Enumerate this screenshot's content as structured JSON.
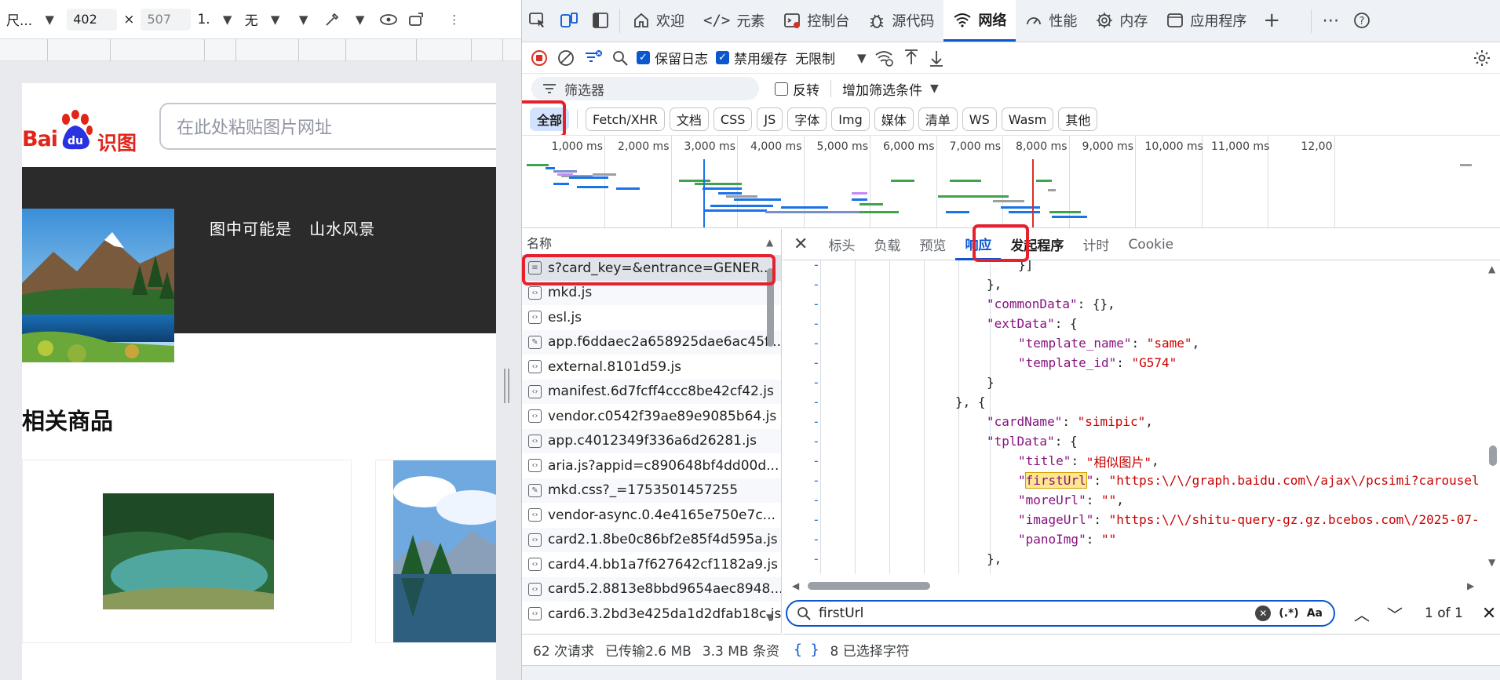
{
  "device_toolbar": {
    "dimensions_label": "尺...",
    "width_value": "402",
    "times_sign": "×",
    "height_value": "507",
    "zoom_label": "1.",
    "throttle_label": "无"
  },
  "page": {
    "logo_text_left": "Bai",
    "logo_paw_text": "du",
    "logo_text_right": "识图",
    "search_placeholder": "在此处粘贴图片网址",
    "result_label": "图中可能是",
    "result_value": "山水风景",
    "related_title": "相关商品"
  },
  "devtools_tabs": [
    {
      "name": "welcome",
      "label": "欢迎",
      "icon": "home-icon"
    },
    {
      "name": "elements",
      "label": "元素",
      "icon": "code-brackets-icon"
    },
    {
      "name": "console",
      "label": "控制台",
      "icon": "console-icon"
    },
    {
      "name": "sources",
      "label": "源代码",
      "icon": "bug-icon"
    },
    {
      "name": "network",
      "label": "网络",
      "icon": "wifi-icon"
    },
    {
      "name": "performance",
      "label": "性能",
      "icon": "gauge-icon"
    },
    {
      "name": "memory",
      "label": "内存",
      "icon": "chip-icon"
    },
    {
      "name": "application",
      "label": "应用程序",
      "icon": "window-icon"
    }
  ],
  "net_toolbar": {
    "preserve_log": "保留日志",
    "disable_cache": "禁用缓存",
    "throttling": "无限制"
  },
  "filter": {
    "placeholder": "筛选器",
    "invert": "反转",
    "more_filters": "增加筛选条件"
  },
  "type_filters": [
    "全部",
    "Fetch/XHR",
    "文档",
    "CSS",
    "JS",
    "字体",
    "Img",
    "媒体",
    "清单",
    "WS",
    "Wasm",
    "其他"
  ],
  "timeline": {
    "ticks": [
      "1,000 ms",
      "2,000 ms",
      "3,000 ms",
      "4,000 ms",
      "5,000 ms",
      "6,000 ms",
      "7,000 ms",
      "8,000 ms",
      "9,000 ms",
      "10,000 ms",
      "11,000 ms",
      "12,00"
    ]
  },
  "requests": {
    "header": "名称",
    "items": [
      {
        "name": "s?card_key=&entrance=GENER...",
        "icon": "document-icon"
      },
      {
        "name": "mkd.js",
        "icon": "script-icon"
      },
      {
        "name": "esl.js",
        "icon": "script-icon"
      },
      {
        "name": "app.f6ddaec2a658925dae6ac45f...",
        "icon": "stylesheet-icon"
      },
      {
        "name": "external.8101d59.js",
        "icon": "script-icon"
      },
      {
        "name": "manifest.6d7fcff4ccc8be42cf42.js",
        "icon": "script-icon"
      },
      {
        "name": "vendor.c0542f39ae89e9085b64.js",
        "icon": "script-icon"
      },
      {
        "name": "app.c4012349f336a6d26281.js",
        "icon": "script-icon"
      },
      {
        "name": "aria.js?appid=c890648bf4dd00d...",
        "icon": "script-icon"
      },
      {
        "name": "mkd.css?_=1753501457255",
        "icon": "stylesheet-icon"
      },
      {
        "name": "vendor-async.0.4e4165e750e7c...",
        "icon": "script-icon"
      },
      {
        "name": "card2.1.8be0c86bf2e85f4d595a.js",
        "icon": "script-icon"
      },
      {
        "name": "card4.4.bb1a7f627642cf1182a9.js",
        "icon": "script-icon"
      },
      {
        "name": "card5.2.8813e8bbd9654aec8948...",
        "icon": "script-icon"
      },
      {
        "name": "card6.3.2bd3e425da1d2dfab18c.js",
        "icon": "script-icon"
      }
    ]
  },
  "detail_tabs": [
    "标头",
    "负载",
    "预览",
    "响应",
    "发起程序",
    "计时",
    "Cookie"
  ],
  "code_lines": [
    {
      "indent": 7,
      "tokens": [
        [
          "p",
          "}]"
        ]
      ]
    },
    {
      "indent": 6,
      "tokens": [
        [
          "p",
          "},"
        ]
      ]
    },
    {
      "indent": 6,
      "tokens": [
        [
          "k",
          "\"commonData\""
        ],
        [
          "p",
          ": {},"
        ]
      ]
    },
    {
      "indent": 6,
      "tokens": [
        [
          "k",
          "\"extData\""
        ],
        [
          "p",
          ": {"
        ]
      ]
    },
    {
      "indent": 7,
      "tokens": [
        [
          "k",
          "\"template_name\""
        ],
        [
          "p",
          ": "
        ],
        [
          "s",
          "\"same\""
        ],
        [
          "p",
          ","
        ]
      ]
    },
    {
      "indent": 7,
      "tokens": [
        [
          "k",
          "\"template_id\""
        ],
        [
          "p",
          ": "
        ],
        [
          "s",
          "\"G574\""
        ]
      ]
    },
    {
      "indent": 6,
      "tokens": [
        [
          "p",
          "}"
        ]
      ]
    },
    {
      "indent": 5,
      "tokens": [
        [
          "p",
          "}, {"
        ]
      ]
    },
    {
      "indent": 6,
      "tokens": [
        [
          "k",
          "\"cardName\""
        ],
        [
          "p",
          ": "
        ],
        [
          "s",
          "\"simipic\""
        ],
        [
          "p",
          ","
        ]
      ]
    },
    {
      "indent": 6,
      "tokens": [
        [
          "k",
          "\"tplData\""
        ],
        [
          "p",
          ": {"
        ]
      ]
    },
    {
      "indent": 7,
      "tokens": [
        [
          "k",
          "\"title\""
        ],
        [
          "p",
          ": "
        ],
        [
          "s",
          "\"相似图片\""
        ],
        [
          "p",
          ","
        ]
      ]
    },
    {
      "indent": 7,
      "tokens": [
        [
          "k",
          "\""
        ],
        [
          "h",
          "firstUrl"
        ],
        [
          "k",
          "\""
        ],
        [
          "p",
          ": "
        ],
        [
          "s",
          "\"https:\\/\\/graph.baidu.com\\/ajax\\/pcsimi?carousel"
        ]
      ]
    },
    {
      "indent": 7,
      "tokens": [
        [
          "k",
          "\"moreUrl\""
        ],
        [
          "p",
          ": "
        ],
        [
          "s",
          "\"\""
        ],
        [
          "p",
          ","
        ]
      ]
    },
    {
      "indent": 7,
      "tokens": [
        [
          "k",
          "\"imageUrl\""
        ],
        [
          "p",
          ": "
        ],
        [
          "s",
          "\"https:\\/\\/shitu-query-gz.gz.bcebos.com\\/2025-07-"
        ]
      ]
    },
    {
      "indent": 7,
      "tokens": [
        [
          "k",
          "\"panoImg\""
        ],
        [
          "p",
          ": "
        ],
        [
          "s",
          "\"\""
        ]
      ]
    },
    {
      "indent": 6,
      "tokens": [
        [
          "p",
          "},"
        ]
      ]
    }
  ],
  "search": {
    "query": "firstUrl",
    "regex_label": "(.*)",
    "case_label": "Aa",
    "match_count": "1 of 1"
  },
  "status": {
    "requests": "62 次请求",
    "transferred": "已传输2.6 MB",
    "resources": "3.3 MB 条资",
    "braces": "{ }",
    "selected": "8 已选择字符"
  },
  "colors": {
    "accent": "#0b57d0",
    "highlight_box": "#e5212e",
    "baidu_red": "#e1251b",
    "baidu_blue": "#2932e1"
  }
}
